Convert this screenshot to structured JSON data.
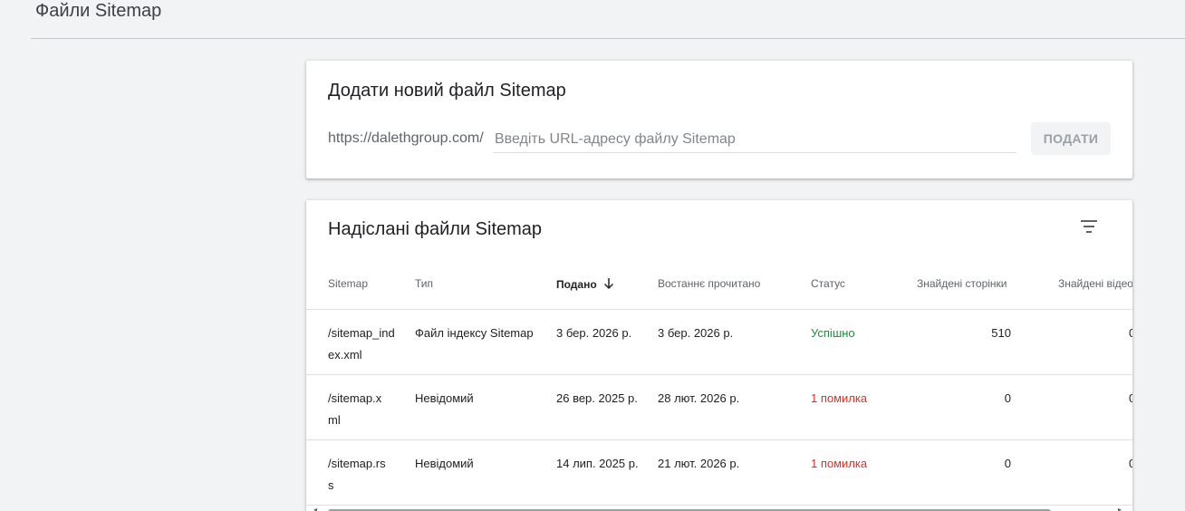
{
  "page": {
    "title": "Файли Sitemap"
  },
  "add_sitemap": {
    "title": "Додати новий файл Sitemap",
    "url_prefix": "https://dalethgroup.com/",
    "input_placeholder": "Введіть URL-адресу файлу Sitemap",
    "input_value": "",
    "submit_label": "ПОДАТИ"
  },
  "submitted": {
    "title": "Надіслані файли Sitemap",
    "filter_icon": "filter-list-icon",
    "columns": [
      "Sitemap",
      "Тип",
      "Подано",
      "Востаннє прочитано",
      "Статус",
      "Знайдені сторінки",
      "Знайдені відео"
    ],
    "sorted_column": "Подано",
    "sort_direction": "descending",
    "rows": [
      {
        "sitemap": "/sitemap_index.xml",
        "type": "Файл індексу Sitemap",
        "submitted": "3 бер. 2026 р.",
        "last_read": "3 бер. 2026 р.",
        "status": "Успішно",
        "status_kind": "success",
        "pages": "510",
        "videos": "0"
      },
      {
        "sitemap": "/sitemap.xml",
        "type": "Невідомий",
        "submitted": "26 вер. 2025 р.",
        "last_read": "28 лют. 2026 р.",
        "status": "1 помилка",
        "status_kind": "error",
        "pages": "0",
        "videos": "0"
      },
      {
        "sitemap": "/sitemap.rss",
        "type": "Невідомий",
        "submitted": "14 лип. 2025 р.",
        "last_read": "21 лют. 2026 р.",
        "status": "1 помилка",
        "status_kind": "error",
        "pages": "0",
        "videos": "0"
      }
    ]
  },
  "colors": {
    "success": "#1e8e3e",
    "error": "#d93025",
    "background": "#f1f3f4"
  }
}
